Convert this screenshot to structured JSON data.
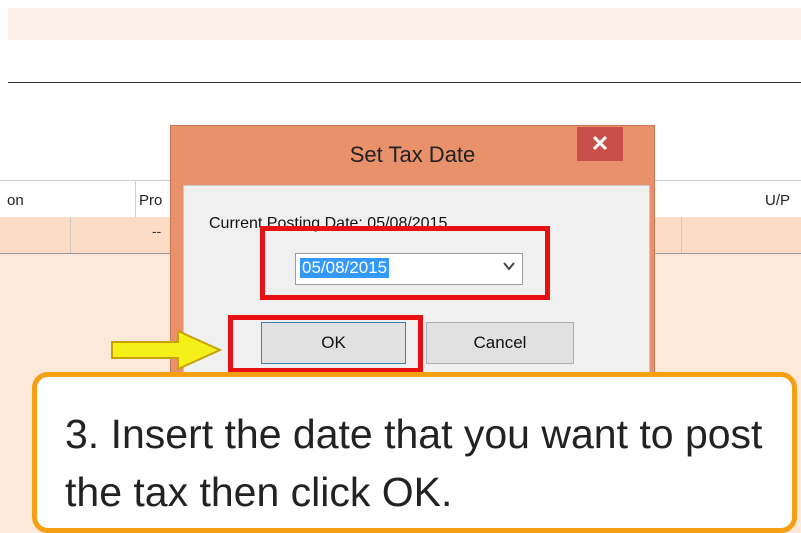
{
  "grid": {
    "col1": "on",
    "col2": "Pro",
    "col3": "U/P",
    "row_dash": "--"
  },
  "dialog": {
    "title": "Set Tax Date",
    "close_glyph": "✕",
    "current_posting_label": "Current Posting Date: 05/08/2015",
    "date_value": "05/08/2015",
    "ok_label": "OK",
    "cancel_label": "Cancel"
  },
  "callout": {
    "text": "3. Insert the date that you want to post the tax then click OK."
  },
  "colors": {
    "title_bar": "#e8916a",
    "highlight": "#e81010",
    "callout_border": "#f59f12",
    "arrow": "#f5f019"
  },
  "icons": {
    "arrow": "pointer-arrow-icon",
    "dropdown": "chevron-down-icon",
    "close": "close-icon"
  }
}
